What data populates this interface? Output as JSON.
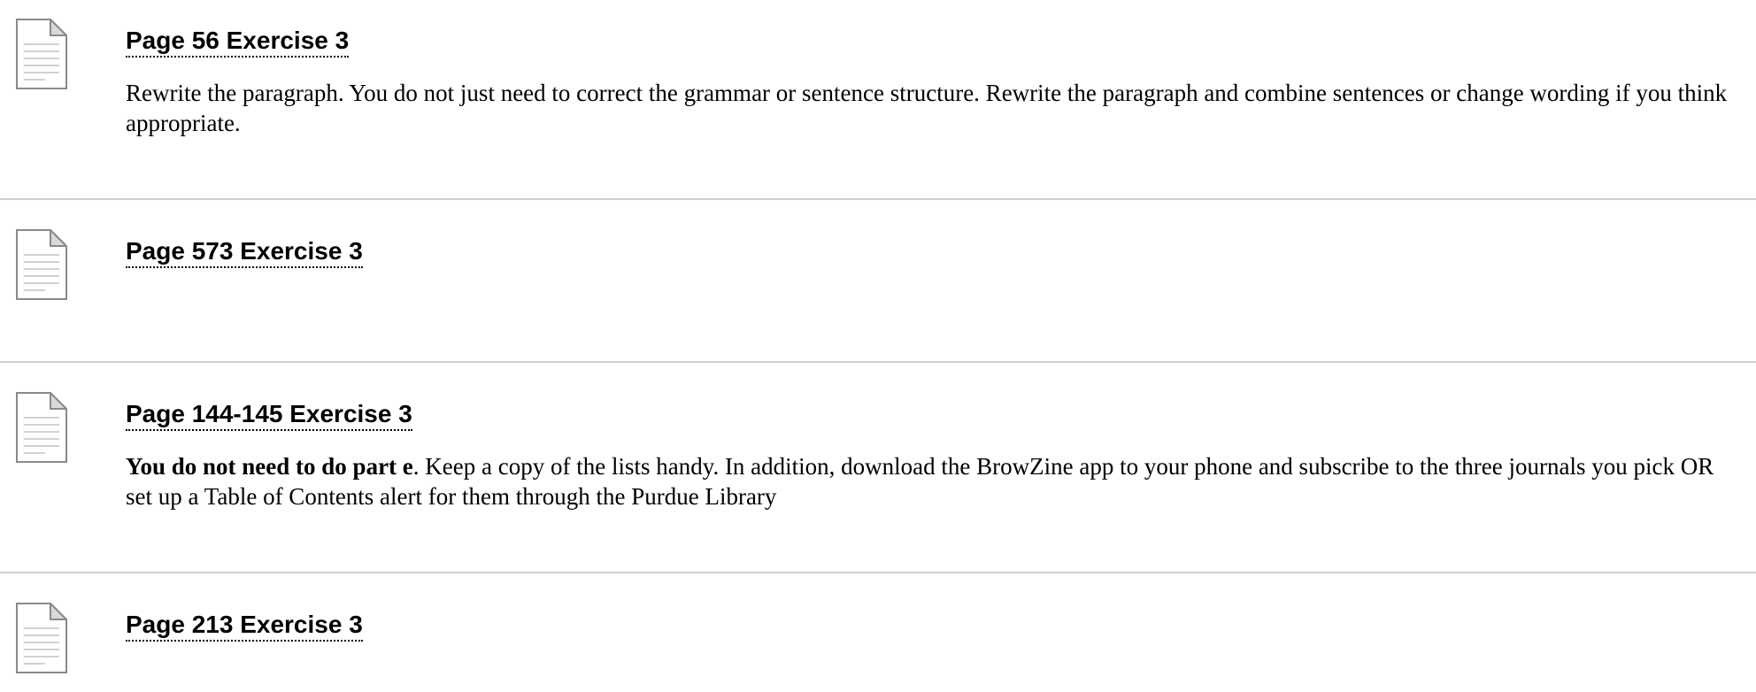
{
  "items": [
    {
      "title": "Page 56 Exercise 3",
      "description": "Rewrite the paragraph. You do not just need to correct the grammar or sentence structure. Rewrite the paragraph and combine sentences or change wording if you think appropriate.",
      "icon": "document-icon"
    },
    {
      "title": "Page 573 Exercise 3",
      "description": "",
      "icon": "document-icon"
    },
    {
      "title": "Page 144-145 Exercise 3",
      "description_bold": "You do not need to do part e",
      "description": ". Keep a copy of the lists handy. In addition, download the BrowZine app to your phone and subscribe to the three journals you pick OR set up a Table of Contents alert for them through the Purdue Library",
      "icon": "document-icon"
    },
    {
      "title": "Page 213 Exercise 3",
      "description": "",
      "icon": "document-icon"
    }
  ],
  "colors": {
    "divider": "#cfcfcf",
    "icon_stroke": "#8a8a8a",
    "icon_fold": "#d9d9d9",
    "text": "#000000"
  }
}
